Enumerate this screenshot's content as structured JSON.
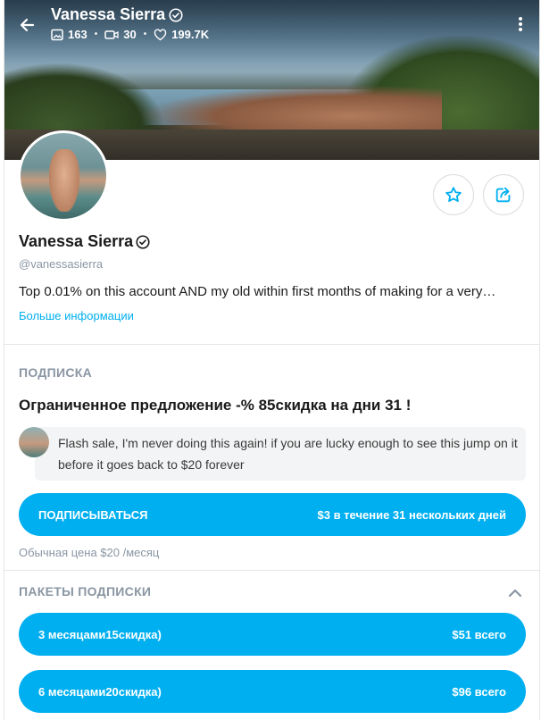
{
  "header": {
    "title": "Vanessa Sierra",
    "stats": {
      "photos": "163",
      "videos": "30",
      "likes": "199.7K"
    }
  },
  "profile": {
    "name": "Vanessa Sierra",
    "handle": "@vanessasierra",
    "bio": "Top 0.01% on this account AND my old within first months of making for a very…",
    "more_info": "Больше информации"
  },
  "subscription": {
    "section_title": "ПОДПИСКА",
    "offer_title": "Ограниченное предложение -% 85скидка на дни 31 !",
    "message": "Flash sale, I'm never doing this again! if you are lucky enough to see this jump on it before it goes back to $20 forever",
    "subscribe_label": "ПОДПИСЫВАТЬСЯ",
    "subscribe_price": "$3 в течение 31 нескольких дней",
    "regular_price": "Обычная цена $20 /месяц"
  },
  "bundles": {
    "section_title": "ПАКЕТЫ ПОДПИСКИ",
    "items": [
      {
        "label": "3 месяцами15скидка)",
        "price": "$51 всего"
      },
      {
        "label": "6 месяцами20скидка)",
        "price": "$96 всего"
      }
    ]
  },
  "colors": {
    "accent": "#00aff0",
    "muted": "#8a96a3",
    "text": "#1a1a1a"
  },
  "icons": [
    "back-arrow-icon",
    "image-icon",
    "video-icon",
    "heart-icon",
    "more-vertical-icon",
    "verified-icon",
    "star-icon",
    "share-icon",
    "chevron-up-icon"
  ]
}
